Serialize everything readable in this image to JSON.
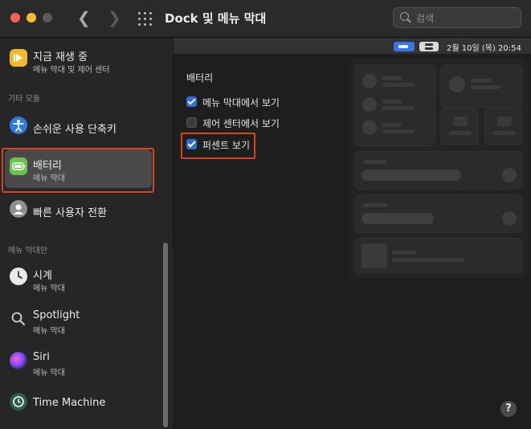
{
  "window": {
    "title": "Dock 및 메뉴 막대",
    "search_placeholder": "검색"
  },
  "sidebar": {
    "top_item": {
      "name": "지금 재생 중",
      "sub": "메뉴 막대 및 제어 센터"
    },
    "section_other": "기타 모듈",
    "other_items": [
      {
        "name": "손쉬운 사용 단축키"
      },
      {
        "name": "배터리",
        "sub": "메뉴 막대"
      },
      {
        "name": "빠른 사용자 전환"
      }
    ],
    "section_menubar_only": "메뉴 막대만",
    "menubar_items": [
      {
        "name": "시계",
        "sub": "메뉴 막대"
      },
      {
        "name": "Spotlight",
        "sub": "메뉴 막대"
      },
      {
        "name": "Siri",
        "sub": "메뉴 막대"
      },
      {
        "name": "Time Machine"
      }
    ]
  },
  "menubar_preview": {
    "datetime": "2월 10일 (목)  20:54"
  },
  "battery_panel": {
    "heading": "배터리",
    "options": [
      {
        "label": "메뉴 막대에서 보기",
        "checked": true
      },
      {
        "label": "제어 센터에서 보기",
        "checked": false
      },
      {
        "label": "퍼센트 보기",
        "checked": true
      }
    ]
  },
  "help_label": "?",
  "colors": {
    "accent": "#2f6fd8",
    "highlight": "#d6461d",
    "selected_row": "#4a4a4d"
  }
}
